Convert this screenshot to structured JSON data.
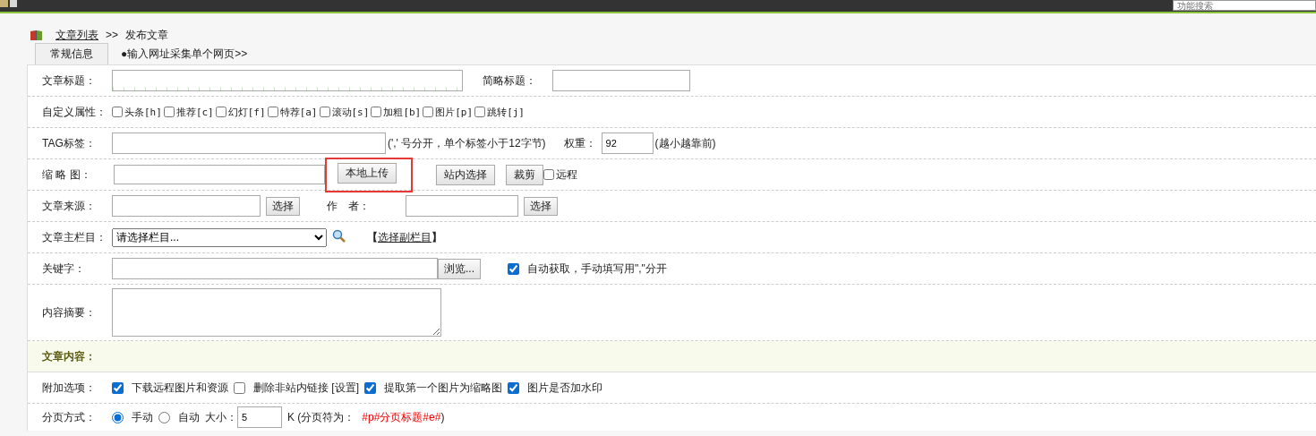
{
  "top_bar": {
    "search_placeholder": "功能搜索"
  },
  "breadcrumb": {
    "link": "文章列表",
    "separator": ">>",
    "current": "发布文章"
  },
  "tabs": [
    {
      "label": "常规信息",
      "selected": true
    },
    {
      "label": "●输入网址采集单个网页>>",
      "selected": false
    }
  ],
  "form": {
    "title": {
      "label": "文章标题：",
      "short_title_label": "简略标题："
    },
    "attributes": {
      "label": "自定义属性：",
      "options": [
        {
          "label": "头条[h]",
          "checked": false
        },
        {
          "label": "推荐[c]",
          "checked": false
        },
        {
          "label": "幻灯[f]",
          "checked": false
        },
        {
          "label": "特荐[a]",
          "checked": false
        },
        {
          "label": "滚动[s]",
          "checked": false
        },
        {
          "label": "加粗[b]",
          "checked": false
        },
        {
          "label": "图片[p]",
          "checked": false
        },
        {
          "label": "跳转[j]",
          "checked": false
        }
      ]
    },
    "tag": {
      "label": "TAG标签：",
      "hint": "(',' 号分开，单个标签小于12字节)",
      "weight_label": "权重：",
      "weight_value": "92",
      "weight_hint": "(越小越靠前)"
    },
    "thumbnail": {
      "label": "缩 略 图：",
      "buttons": [
        {
          "label": "本地上传",
          "highlighted": true
        },
        {
          "label": "站内选择",
          "highlighted": false
        },
        {
          "label": "裁剪",
          "highlighted": false
        }
      ],
      "remote": {
        "label": "远程",
        "checked": false
      }
    },
    "source": {
      "label": "文章来源：",
      "button": "选择",
      "author_label": "作　者：",
      "author_button": "选择"
    },
    "column": {
      "label": "文章主栏目：",
      "select_value": "请选择栏目...",
      "sub_prefix": "【",
      "sub_link": "选择副栏目",
      "sub_suffix": "】"
    },
    "keywords": {
      "label": "关键字：",
      "browse_button": "浏览...",
      "auto": {
        "label": "自动获取，手动填写用\",\"分开",
        "checked": true
      }
    },
    "summary": {
      "label": "内容摘要："
    },
    "content_section": {
      "title": "文章内容："
    },
    "extra_options": {
      "label": "附加选项：",
      "options": [
        {
          "label": "下载远程图片和资源",
          "checked": true
        },
        {
          "label": "删除非站内链接 [设置]",
          "checked": false
        },
        {
          "label": "提取第一个图片为缩略图",
          "checked": true
        },
        {
          "label": "图片是否加水印",
          "checked": true
        }
      ]
    },
    "paging": {
      "label": "分页方式：",
      "modes": [
        {
          "label": "手动",
          "selected": true
        },
        {
          "label": "自动",
          "selected": false
        }
      ],
      "size_label": "大小：",
      "size_value": "5",
      "unit_hint": "K (分页符为：",
      "marker": "#p#分页标题#e#",
      "close": " )"
    }
  }
}
